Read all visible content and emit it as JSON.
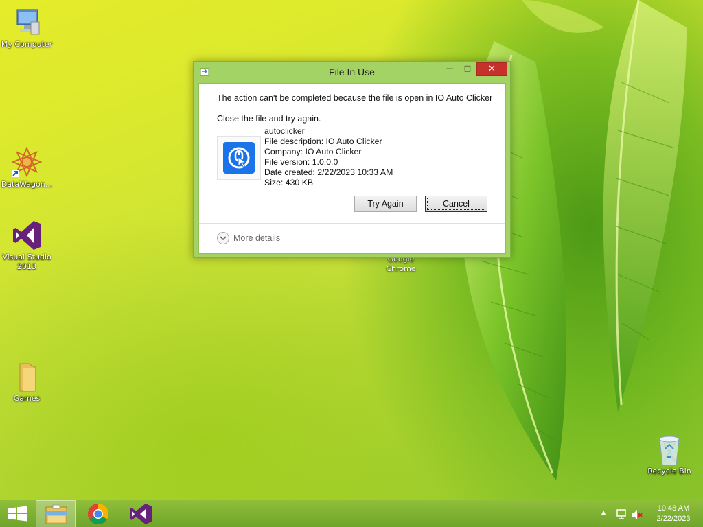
{
  "desktop": {
    "icons": [
      {
        "label": "My Computer",
        "icon": "computer-icon"
      },
      {
        "label": "DataWagon...",
        "icon": "datawagon-icon"
      },
      {
        "label": "Visual Studio 2013",
        "icon": "visual-studio-icon"
      },
      {
        "label": "Games",
        "icon": "folder-icon"
      },
      {
        "label": "Recycle Bin",
        "icon": "recycle-bin-icon"
      }
    ],
    "chrome_label": "Google Chrome"
  },
  "dialog": {
    "title": "File In Use",
    "message": "The action can't be completed because the file is open in IO Auto Clicker",
    "instruction": "Close the file and try again.",
    "file": {
      "name": "autoclicker",
      "description": "File description: IO Auto Clicker",
      "company": "Company: IO Auto Clicker",
      "version": "File version: 1.0.0.0",
      "date_created": "Date created: 2/22/2023 10:33 AM",
      "size": "Size: 430 KB",
      "icon": "io-auto-clicker-icon"
    },
    "buttons": {
      "try_again": "Try Again",
      "cancel": "Cancel"
    },
    "more_details": "More details",
    "title_buttons": {
      "minimize": "—",
      "maximize": "□",
      "close": "✕"
    },
    "colors": {
      "frame": "#a3d265",
      "close": "#c7312b"
    }
  },
  "taskbar": {
    "items": [
      {
        "icon": "windows-start-icon"
      },
      {
        "icon": "file-explorer-icon",
        "active": true
      },
      {
        "icon": "chrome-icon"
      },
      {
        "icon": "visual-studio-icon"
      }
    ],
    "tray": {
      "up_arrow": "▲"
    },
    "clock": {
      "time": "10:48 AM",
      "date": "2/22/2023"
    }
  }
}
